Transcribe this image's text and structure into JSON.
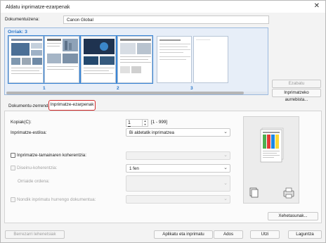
{
  "window": {
    "title": "Aldatu inprimatze-ezarpenak",
    "close_glyph": "✕"
  },
  "document_name": {
    "label": "Dokumentuizena:",
    "value": "Canon Global"
  },
  "preview": {
    "pages_label": "Orriak: 3",
    "page_numbers": [
      "1",
      "2",
      "3"
    ],
    "delete_button": "Ezabatu",
    "reorder_button": "Inprimatzeko aurrebista..."
  },
  "tabs": [
    {
      "label": "Dokumentu-zerrenda",
      "active": false
    },
    {
      "label": "Inprimatze-ezarpenak",
      "active": true
    }
  ],
  "settings": {
    "copies_label": "Kopiak(C):",
    "copies_value": "1",
    "copies_range": "[1 - 999]",
    "style_label": "Inprimatze-estiloa:",
    "style_value": "Bi aldetatik inprimatzea",
    "fit_size_label": "Inprimatze-tamainaren koherentzia:",
    "layout_label": "Diseinu-koherentzia:",
    "layout_value": "1 fen",
    "order_label": "Orriaide ordena:",
    "combine_label": "Nondik inprimatu hurrengo dokumentua:",
    "more_button": "Xehetasunak..."
  },
  "footer": {
    "restore_button": "Berrezarri lehenetsiak",
    "apply_print_button": "Aplikatu eta inprimatu",
    "ok_button": "Ados",
    "cancel_button": "Utzi",
    "help_button": "Laguntza"
  },
  "colors": {
    "accent": "#2a77c9",
    "highlight_border": "#d22a2a",
    "preview_bg": "#e7eef8"
  },
  "icons": [
    "close-icon",
    "chevron-down-icon",
    "spin-up-icon",
    "spin-down-icon",
    "stack-icon",
    "printer-icon"
  ]
}
